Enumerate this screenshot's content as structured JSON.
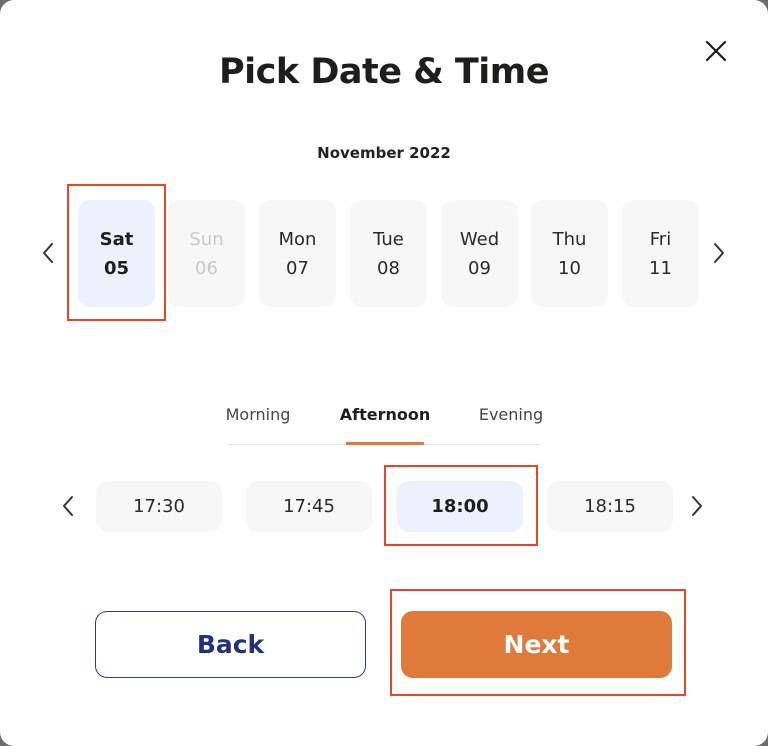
{
  "modal": {
    "title": "Pick Date & Time",
    "close_icon": "close-icon",
    "month_label": "November 2022"
  },
  "dates": {
    "prev_icon": "chevron-left-icon",
    "next_icon": "chevron-right-icon",
    "selected_index": 0,
    "items": [
      {
        "weekday": "Sat",
        "day": "05",
        "state": "selected"
      },
      {
        "weekday": "Sun",
        "day": "06",
        "state": "disabled"
      },
      {
        "weekday": "Mon",
        "day": "07",
        "state": "available"
      },
      {
        "weekday": "Tue",
        "day": "08",
        "state": "available"
      },
      {
        "weekday": "Wed",
        "day": "09",
        "state": "available"
      },
      {
        "weekday": "Thu",
        "day": "10",
        "state": "available"
      },
      {
        "weekday": "Fri",
        "day": "11",
        "state": "available"
      }
    ]
  },
  "time_of_day_tabs": {
    "active": "Afternoon",
    "items": [
      "Morning",
      "Afternoon",
      "Evening"
    ]
  },
  "time_slots": {
    "prev_icon": "chevron-left-icon",
    "next_icon": "chevron-right-icon",
    "selected": "18:00",
    "items": [
      "17:30",
      "17:45",
      "18:00",
      "18:15"
    ]
  },
  "actions": {
    "back_label": "Back",
    "next_label": "Next"
  },
  "colors": {
    "accent_orange": "#e07a3a",
    "back_navy": "#22307f",
    "selected_bg": "#ecf1fd",
    "card_bg": "#f7f7f7",
    "highlight_red": "#e8452c"
  }
}
